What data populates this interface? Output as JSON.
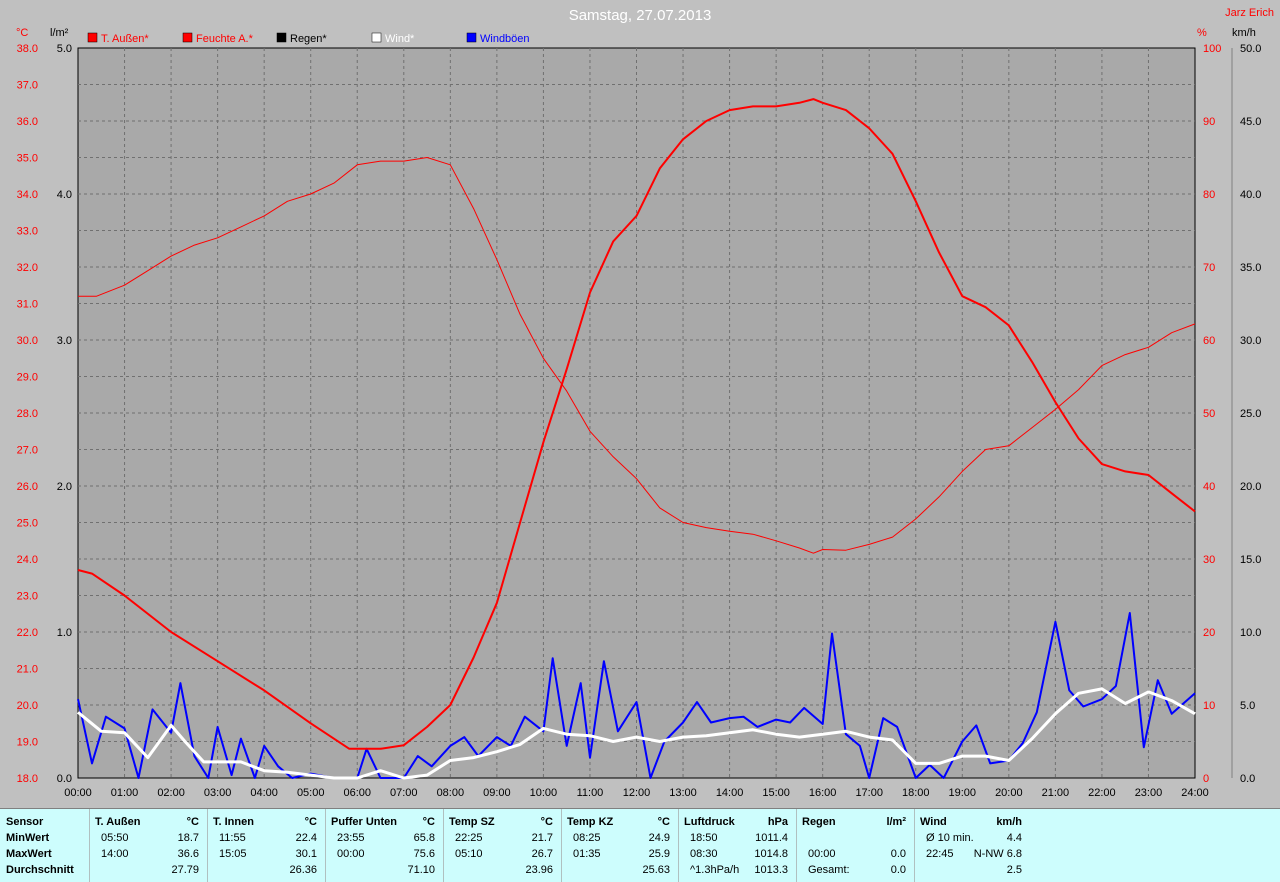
{
  "header": {
    "title": "Samstag, 27.07.2013",
    "author": "Jarz Erich"
  },
  "legend": [
    {
      "label": "T. Außen*",
      "color": "#ff0000"
    },
    {
      "label": "Feuchte A.*",
      "color": "#ff0000"
    },
    {
      "label": "Regen*",
      "color": "#000000"
    },
    {
      "label": "Wind*",
      "color": "#ffffff"
    },
    {
      "label": "Windböen",
      "color": "#0000ff"
    }
  ],
  "axes": {
    "temp_unit": "°C",
    "rain_unit": "l/m²",
    "hum_unit": "%",
    "wind_unit": "km/h",
    "temp_ticks": [
      "38.0",
      "37.0",
      "36.0",
      "35.0",
      "34.0",
      "33.0",
      "32.0",
      "31.0",
      "30.0",
      "29.0",
      "28.0",
      "27.0",
      "26.0",
      "25.0",
      "24.0",
      "23.0",
      "22.0",
      "21.0",
      "20.0",
      "19.0",
      "18.0"
    ],
    "rain_ticks": [
      "5.0",
      "4.0",
      "3.0",
      "2.0",
      "1.0",
      "0.0"
    ],
    "hum_ticks": [
      "100",
      "90",
      "80",
      "70",
      "60",
      "50",
      "40",
      "30",
      "20",
      "10",
      "0"
    ],
    "wind_ticks": [
      "50.0",
      "45.0",
      "40.0",
      "35.0",
      "30.0",
      "25.0",
      "20.0",
      "15.0",
      "10.0",
      "5.0",
      "0.0"
    ],
    "time_ticks": [
      "00:00",
      "01:00",
      "02:00",
      "03:00",
      "04:00",
      "05:00",
      "06:00",
      "07:00",
      "08:00",
      "09:00",
      "10:00",
      "11:00",
      "12:00",
      "13:00",
      "14:00",
      "15:00",
      "16:00",
      "17:00",
      "18:00",
      "19:00",
      "20:00",
      "21:00",
      "22:00",
      "23:00",
      "24:00"
    ]
  },
  "chart_data": {
    "type": "line",
    "x_unit": "hours",
    "ylim_temp": [
      18,
      38
    ],
    "ylim_hum": [
      0,
      100
    ],
    "ylim_wind": [
      0,
      50
    ],
    "ylim_rain": [
      0,
      5
    ],
    "series": [
      {
        "name": "T. Außen*",
        "axis": "temp",
        "color": "#ff0000",
        "width": 2,
        "points": [
          [
            0,
            23.7
          ],
          [
            0.3,
            23.6
          ],
          [
            1,
            23.0
          ],
          [
            2,
            22.0
          ],
          [
            3,
            21.2
          ],
          [
            4,
            20.4
          ],
          [
            5,
            19.5
          ],
          [
            5.83,
            18.8
          ],
          [
            6,
            18.8
          ],
          [
            6.5,
            18.8
          ],
          [
            7,
            18.9
          ],
          [
            7.5,
            19.4
          ],
          [
            8,
            20.0
          ],
          [
            8.5,
            21.3
          ],
          [
            9,
            22.8
          ],
          [
            9.5,
            25.0
          ],
          [
            10,
            27.2
          ],
          [
            10.5,
            29.2
          ],
          [
            11,
            31.3
          ],
          [
            11.5,
            32.7
          ],
          [
            12,
            33.4
          ],
          [
            12.5,
            34.7
          ],
          [
            13,
            35.5
          ],
          [
            13.5,
            36.0
          ],
          [
            14,
            36.3
          ],
          [
            14.5,
            36.4
          ],
          [
            15,
            36.4
          ],
          [
            15.5,
            36.5
          ],
          [
            15.8,
            36.6
          ],
          [
            16,
            36.5
          ],
          [
            16.5,
            36.3
          ],
          [
            17,
            35.8
          ],
          [
            17.5,
            35.1
          ],
          [
            18,
            33.8
          ],
          [
            18.5,
            32.4
          ],
          [
            19,
            31.2
          ],
          [
            19.5,
            30.9
          ],
          [
            20,
            30.4
          ],
          [
            20.5,
            29.4
          ],
          [
            21,
            28.3
          ],
          [
            21.5,
            27.3
          ],
          [
            22,
            26.6
          ],
          [
            22.5,
            26.4
          ],
          [
            23,
            26.3
          ],
          [
            23.5,
            25.8
          ],
          [
            24,
            25.3
          ]
        ]
      },
      {
        "name": "Feuchte A.*",
        "axis": "hum",
        "color": "#ff0000",
        "width": 1,
        "points": [
          [
            0,
            66
          ],
          [
            0.4,
            66
          ],
          [
            1,
            67.5
          ],
          [
            1.5,
            69.5
          ],
          [
            2,
            71.5
          ],
          [
            2.5,
            73
          ],
          [
            3,
            74
          ],
          [
            3.5,
            75.5
          ],
          [
            4,
            77
          ],
          [
            4.5,
            79
          ],
          [
            5,
            80
          ],
          [
            5.5,
            81.5
          ],
          [
            6,
            84
          ],
          [
            6.5,
            84.5
          ],
          [
            7,
            84.5
          ],
          [
            7.5,
            85
          ],
          [
            8,
            84
          ],
          [
            8.5,
            78
          ],
          [
            9,
            71
          ],
          [
            9.5,
            63.5
          ],
          [
            10,
            57.5
          ],
          [
            10.5,
            53
          ],
          [
            11,
            47.5
          ],
          [
            11.5,
            44
          ],
          [
            12,
            41
          ],
          [
            12.5,
            37
          ],
          [
            13,
            35
          ],
          [
            13.5,
            34.3
          ],
          [
            14,
            33.8
          ],
          [
            14.5,
            33.4
          ],
          [
            15,
            32.5
          ],
          [
            15.5,
            31.5
          ],
          [
            15.8,
            30.8
          ],
          [
            16,
            31.3
          ],
          [
            16.5,
            31.2
          ],
          [
            17,
            32
          ],
          [
            17.5,
            33
          ],
          [
            18,
            35.5
          ],
          [
            18.5,
            38.5
          ],
          [
            19,
            42
          ],
          [
            19.5,
            45
          ],
          [
            20,
            45.5
          ],
          [
            20.5,
            48
          ],
          [
            21,
            50.5
          ],
          [
            21.5,
            53.2
          ],
          [
            22,
            56.5
          ],
          [
            22.5,
            58
          ],
          [
            23,
            59
          ],
          [
            23.5,
            61
          ],
          [
            24,
            62.2
          ]
        ]
      },
      {
        "name": "Wind*",
        "axis": "wind",
        "color": "#ffffff",
        "width": 3,
        "points": [
          [
            0,
            4.5
          ],
          [
            0.5,
            3.2
          ],
          [
            1,
            3.1
          ],
          [
            1.5,
            1.4
          ],
          [
            2,
            3.6
          ],
          [
            2.3,
            2.5
          ],
          [
            2.7,
            1.1
          ],
          [
            3.2,
            1.1
          ],
          [
            3.5,
            1.1
          ],
          [
            4,
            0.5
          ],
          [
            4.5,
            0.4
          ],
          [
            5,
            0.2
          ],
          [
            5.5,
            0
          ],
          [
            6,
            0
          ],
          [
            6.5,
            0.5
          ],
          [
            7,
            0
          ],
          [
            7.5,
            0.2
          ],
          [
            8,
            1.2
          ],
          [
            8.5,
            1.4
          ],
          [
            9,
            1.8
          ],
          [
            9.5,
            2.3
          ],
          [
            10,
            3.4
          ],
          [
            10.5,
            3.0
          ],
          [
            11,
            2.9
          ],
          [
            11.5,
            2.5
          ],
          [
            12,
            2.8
          ],
          [
            12.5,
            2.5
          ],
          [
            13,
            2.8
          ],
          [
            13.5,
            2.9
          ],
          [
            14,
            3.1
          ],
          [
            14.5,
            3.3
          ],
          [
            15,
            3.0
          ],
          [
            15.5,
            2.8
          ],
          [
            16,
            3.0
          ],
          [
            16.5,
            3.2
          ],
          [
            17,
            2.8
          ],
          [
            17.5,
            2.6
          ],
          [
            18,
            1.0
          ],
          [
            18.5,
            1.0
          ],
          [
            19,
            1.5
          ],
          [
            19.5,
            1.5
          ],
          [
            20,
            1.2
          ],
          [
            20.5,
            2.7
          ],
          [
            21,
            4.4
          ],
          [
            21.5,
            5.8
          ],
          [
            22,
            6.1
          ],
          [
            22.5,
            5.1
          ],
          [
            23,
            5.9
          ],
          [
            23.5,
            5.3
          ],
          [
            24,
            4.4
          ]
        ]
      },
      {
        "name": "Windböen",
        "axis": "wind",
        "color": "#0000ff",
        "width": 2,
        "points": [
          [
            0,
            5.4
          ],
          [
            0.3,
            1.0
          ],
          [
            0.6,
            4.2
          ],
          [
            1,
            3.4
          ],
          [
            1.3,
            0
          ],
          [
            1.6,
            4.7
          ],
          [
            2,
            3.1
          ],
          [
            2.2,
            6.5
          ],
          [
            2.5,
            1.5
          ],
          [
            2.8,
            0
          ],
          [
            3,
            3.5
          ],
          [
            3.3,
            0.2
          ],
          [
            3.5,
            2.7
          ],
          [
            3.8,
            0
          ],
          [
            4,
            2.2
          ],
          [
            4.3,
            0.8
          ],
          [
            4.6,
            0
          ],
          [
            5,
            0.3
          ],
          [
            5.5,
            0
          ],
          [
            6,
            0
          ],
          [
            6.2,
            2.0
          ],
          [
            6.5,
            0
          ],
          [
            7,
            0
          ],
          [
            7.3,
            1.5
          ],
          [
            7.6,
            0.8
          ],
          [
            8,
            2.2
          ],
          [
            8.3,
            2.8
          ],
          [
            8.6,
            1.5
          ],
          [
            9,
            2.8
          ],
          [
            9.3,
            2.2
          ],
          [
            9.6,
            4.2
          ],
          [
            10,
            3.2
          ],
          [
            10.2,
            8.2
          ],
          [
            10.5,
            2.2
          ],
          [
            10.8,
            6.5
          ],
          [
            11,
            1.4
          ],
          [
            11.3,
            8.0
          ],
          [
            11.6,
            3.2
          ],
          [
            12,
            5.2
          ],
          [
            12.3,
            0
          ],
          [
            12.6,
            2.5
          ],
          [
            13,
            3.8
          ],
          [
            13.3,
            5.2
          ],
          [
            13.6,
            3.8
          ],
          [
            14,
            4.1
          ],
          [
            14.3,
            4.2
          ],
          [
            14.6,
            3.5
          ],
          [
            15,
            4.0
          ],
          [
            15.3,
            3.8
          ],
          [
            15.6,
            4.8
          ],
          [
            16,
            3.7
          ],
          [
            16.2,
            9.9
          ],
          [
            16.5,
            3.0
          ],
          [
            16.8,
            2.2
          ],
          [
            17,
            0
          ],
          [
            17.3,
            4.1
          ],
          [
            17.6,
            3.5
          ],
          [
            18,
            0
          ],
          [
            18.3,
            0.9
          ],
          [
            18.6,
            0
          ],
          [
            19,
            2.5
          ],
          [
            19.3,
            3.6
          ],
          [
            19.6,
            1.0
          ],
          [
            20,
            1.2
          ],
          [
            20.3,
            2.4
          ],
          [
            20.6,
            4.5
          ],
          [
            21,
            10.7
          ],
          [
            21.3,
            6.0
          ],
          [
            21.6,
            4.9
          ],
          [
            22,
            5.4
          ],
          [
            22.3,
            6.3
          ],
          [
            22.6,
            11.3
          ],
          [
            22.9,
            2.1
          ],
          [
            23.2,
            6.7
          ],
          [
            23.5,
            4.4
          ],
          [
            24,
            5.8
          ]
        ]
      }
    ]
  },
  "table": {
    "columns": [
      {
        "title": "Sensor",
        "unit": "",
        "rows": [
          [
            "MinWert",
            ""
          ],
          [
            "MaxWert",
            ""
          ],
          [
            "Durchschnitt",
            ""
          ]
        ]
      },
      {
        "title": "T. Außen",
        "unit": "°C",
        "rows": [
          [
            "05:50",
            "18.7"
          ],
          [
            "14:00",
            "36.6"
          ],
          [
            "",
            "27.79"
          ]
        ]
      },
      {
        "title": "T. Innen",
        "unit": "°C",
        "rows": [
          [
            "11:55",
            "22.4"
          ],
          [
            "15:05",
            "30.1"
          ],
          [
            "",
            "26.36"
          ]
        ]
      },
      {
        "title": "Puffer Unten",
        "unit": "°C",
        "rows": [
          [
            "23:55",
            "65.8"
          ],
          [
            "00:00",
            "75.6"
          ],
          [
            "",
            "71.10"
          ]
        ]
      },
      {
        "title": "Temp SZ",
        "unit": "°C",
        "rows": [
          [
            "22:25",
            "21.7"
          ],
          [
            "05:10",
            "26.7"
          ],
          [
            "",
            "23.96"
          ]
        ]
      },
      {
        "title": "Temp KZ",
        "unit": "°C",
        "rows": [
          [
            "08:25",
            "24.9"
          ],
          [
            "01:35",
            "25.9"
          ],
          [
            "",
            "25.63"
          ]
        ]
      },
      {
        "title": "Luftdruck",
        "unit": "hPa",
        "rows": [
          [
            "18:50",
            "1011.4"
          ],
          [
            "08:30",
            "1014.8"
          ],
          [
            "^1.3hPa/h",
            "1013.3"
          ]
        ]
      },
      {
        "title": "Regen",
        "unit": "l/m²",
        "rows": [
          [
            "",
            ""
          ],
          [
            "00:00",
            "0.0"
          ],
          [
            "Gesamt:",
            "0.0"
          ]
        ]
      },
      {
        "title": "Wind",
        "unit": "km/h",
        "rows": [
          [
            "Ø 10 min.",
            "4.4"
          ],
          [
            "22:45",
            "N-NW 6.8"
          ],
          [
            "",
            "2.5"
          ]
        ]
      }
    ]
  }
}
